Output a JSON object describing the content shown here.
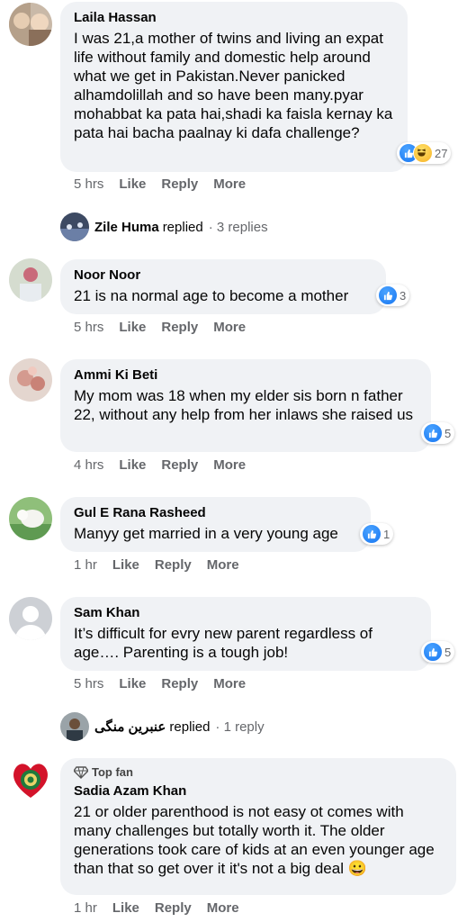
{
  "comments": [
    {
      "author": "Laila Hassan",
      "text": "I was 21,a mother of twins and living an expat life without family and domestic help around what we get in Pakistan.Never panicked alhamdolillah and so have been many.pyar mohabbat ka pata hai,shadi ka faisla kernay ka pata hai bacha paalnay ki dafa challenge?",
      "time": "5 hrs",
      "reactions": "27"
    },
    {
      "author": "Noor Noor",
      "text": "21 is na normal age to become a mother",
      "time": "5 hrs",
      "reactions": "3"
    },
    {
      "author": "Ammi Ki Beti",
      "text": "My mom was 18 when my elder sis born n father 22, without any help from her inlaws she raised us",
      "time": "4 hrs",
      "reactions": "5"
    },
    {
      "author": "Gul E Rana Rasheed",
      "text": "Manyy get married in a very young age",
      "time": "1 hr",
      "reactions": "1"
    },
    {
      "author": "Sam Khan",
      "text": "It’s difficult for evry new parent regardless of age…. Parenting is a tough job!",
      "time": "5 hrs",
      "reactions": "5"
    },
    {
      "badge": "Top fan",
      "author": "Sadia Azam Khan",
      "text": "21 or older parenthood is not easy ot comes with many challenges but totally worth it. The older generations took care of kids at an even younger age than that so get over it it's not a big deal",
      "emoji": "😀",
      "time": "1 hr"
    }
  ],
  "reply_threads": [
    {
      "name": "Zile Huma",
      "label": "replied",
      "count": "· 3 replies"
    },
    {
      "name": "عنبرین منگی",
      "label": "replied",
      "count": "· 1 reply"
    }
  ],
  "actions": {
    "like": "Like",
    "reply": "Reply",
    "more": "More"
  }
}
